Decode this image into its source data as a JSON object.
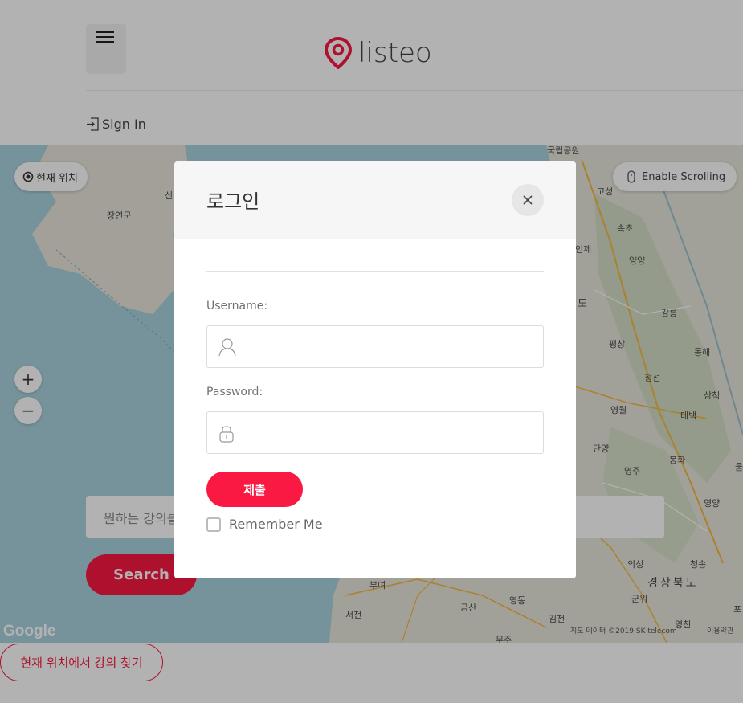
{
  "header": {
    "logo_text": "listeo",
    "signin_label": "Sign In",
    "brand_color": "#f91942"
  },
  "map": {
    "current_location_label": "현재 위치",
    "enable_scrolling_label": "Enable Scrolling",
    "zoom_in_label": "+",
    "zoom_out_label": "−",
    "search_placeholder": "원하는 강의를",
    "search_button_label": "Search",
    "google_label": "Google",
    "attribution": "지도 데이터 ©2019 SK telecom",
    "terms": "이용약관",
    "place_labels": [
      "장연군",
      "신",
      "국립공원",
      "고성",
      "속초",
      "인제",
      "양양",
      "도",
      "강릉",
      "평창",
      "동해",
      "정선",
      "삼척",
      "영월",
      "태백",
      "단양",
      "봉화",
      "영주",
      "울",
      "영양",
      "의성",
      "청송",
      "경상북도",
      "군위",
      "포",
      "부여",
      "금산",
      "영동",
      "서천",
      "김천",
      "영천",
      "무주"
    ]
  },
  "bottom": {
    "nearby_button_label": "현재 위치에서 강의 찾기"
  },
  "modal": {
    "title": "로그인",
    "username_label": "Username:",
    "username_value": "",
    "password_label": "Password:",
    "password_value": "",
    "submit_label": "제출",
    "remember_label": "Remember Me",
    "remember_checked": false
  }
}
